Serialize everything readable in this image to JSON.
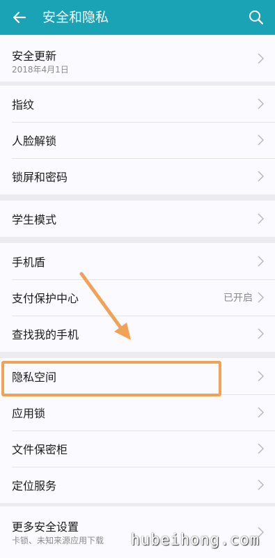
{
  "header": {
    "title": "安全和隐私",
    "back_icon": "arrow-left-icon",
    "search_icon": "search-icon",
    "background": "#1aa3b5"
  },
  "groups": [
    {
      "items": [
        {
          "label": "安全更新",
          "sub": "2018年4月1日"
        }
      ]
    },
    {
      "items": [
        {
          "label": "指纹"
        },
        {
          "label": "人脸解锁"
        },
        {
          "label": "锁屏和密码"
        }
      ]
    },
    {
      "items": [
        {
          "label": "学生模式"
        }
      ]
    },
    {
      "items": [
        {
          "label": "手机盾"
        },
        {
          "label": "支付保护中心",
          "value": "已开启"
        },
        {
          "label": "查找我的手机"
        }
      ]
    },
    {
      "items": [
        {
          "label": "隐私空间"
        },
        {
          "label": "应用锁"
        },
        {
          "label": "文件保密柜"
        },
        {
          "label": "定位服务"
        }
      ]
    },
    {
      "items": [
        {
          "label": "更多安全设置",
          "sub": "卡锁、未知来源应用下载"
        }
      ]
    }
  ],
  "annotation": {
    "highlight_color": "#f0a257",
    "highlighted_item": "隐私空间"
  },
  "watermark": "hubeihong.com"
}
